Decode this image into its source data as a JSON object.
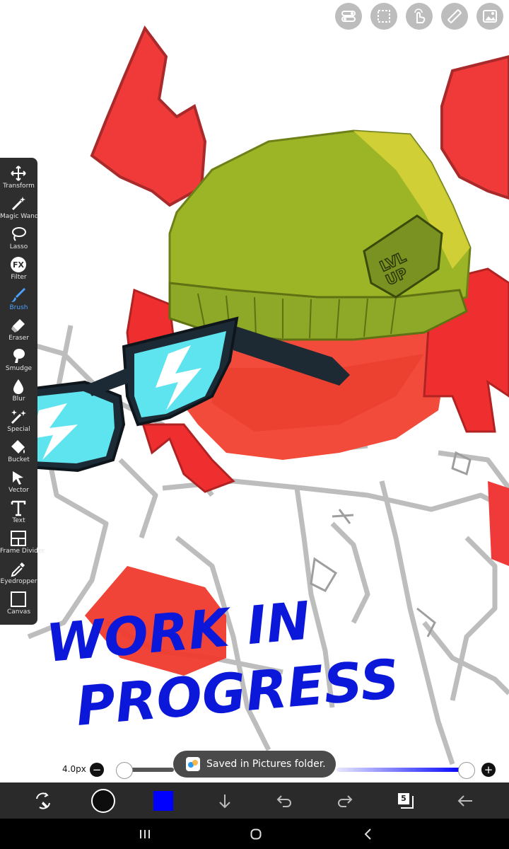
{
  "top_actions": [
    {
      "name": "toggle-icon"
    },
    {
      "name": "selection-icon"
    },
    {
      "name": "gesture-icon"
    },
    {
      "name": "ruler-icon"
    },
    {
      "name": "gallery-icon"
    }
  ],
  "tools": [
    {
      "label": "Transform",
      "icon": "transform-icon"
    },
    {
      "label": "Magic Wand",
      "icon": "magic-wand-icon"
    },
    {
      "label": "Lasso",
      "icon": "lasso-icon"
    },
    {
      "label": "Filter",
      "icon": "filter-icon"
    },
    {
      "label": "Brush",
      "icon": "brush-icon",
      "active": true
    },
    {
      "label": "Eraser",
      "icon": "eraser-icon"
    },
    {
      "label": "Smudge",
      "icon": "smudge-icon"
    },
    {
      "label": "Blur",
      "icon": "blur-icon"
    },
    {
      "label": "Special",
      "icon": "special-icon"
    },
    {
      "label": "Bucket",
      "icon": "bucket-icon"
    },
    {
      "label": "Vector",
      "icon": "vector-icon"
    },
    {
      "label": "Text",
      "icon": "text-icon"
    },
    {
      "label": "Frame Divider",
      "icon": "frame-divider-icon"
    },
    {
      "label": "Eyedropper",
      "icon": "eyedropper-icon"
    },
    {
      "label": "Canvas",
      "icon": "canvas-icon"
    }
  ],
  "canvas": {
    "wip_line1": "WORK IN",
    "wip_line2": "PROGRESS",
    "badge_line1": "LVL",
    "badge_line2": "UP"
  },
  "brush": {
    "size_label": "4.0px",
    "size_fraction": 0.02,
    "opacity_fraction": 1.0
  },
  "toast": {
    "text": "Saved in Pictures folder."
  },
  "bottom": {
    "layers_count": "5",
    "primary_color": "#0d0d0d",
    "secondary_color": "#0000ff"
  },
  "colors": {
    "accent": "#4aa3ff",
    "toolbar": "#2e2e2e",
    "bottombar": "#2a2a2a"
  }
}
